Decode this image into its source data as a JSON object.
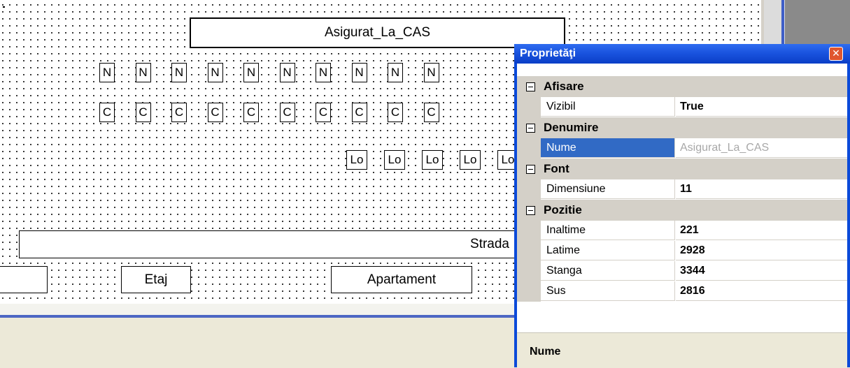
{
  "canvas": {
    "title_field": "Asigurat_La_CAS",
    "n_boxes": [
      "N",
      "N",
      "N",
      "N",
      "N",
      "N",
      "N",
      "N",
      "N",
      "N"
    ],
    "c_boxes": [
      "C",
      "C",
      "C",
      "C",
      "C",
      "C",
      "C",
      "C",
      "C",
      "C"
    ],
    "lo_boxes": [
      "Lo",
      "Lo",
      "Lo",
      "Lo",
      "Lo"
    ],
    "strada_field": "Strada",
    "etaj_field": "Etaj",
    "apartament_field": "Apartament"
  },
  "properties": {
    "title": "Proprietăţi",
    "close_icon": "close-icon",
    "categories": [
      {
        "name": "Afisare",
        "rows": [
          {
            "name": "Vizibil",
            "value": "True"
          }
        ]
      },
      {
        "name": "Denumire",
        "rows": [
          {
            "name": "Nume",
            "value": "Asigurat_La_CAS",
            "selected": true
          }
        ]
      },
      {
        "name": "Font",
        "rows": [
          {
            "name": "Dimensiune",
            "value": "11"
          }
        ]
      },
      {
        "name": "Pozitie",
        "rows": [
          {
            "name": "Inaltime",
            "value": "221"
          },
          {
            "name": "Latime",
            "value": "2928"
          },
          {
            "name": "Stanga",
            "value": "3344"
          },
          {
            "name": "Sus",
            "value": "2816"
          }
        ]
      }
    ],
    "description_title": "Nume",
    "colors": {
      "titlebar": "#0b4ad9",
      "selection": "#316ac5",
      "category": "#d4d0c8"
    }
  }
}
